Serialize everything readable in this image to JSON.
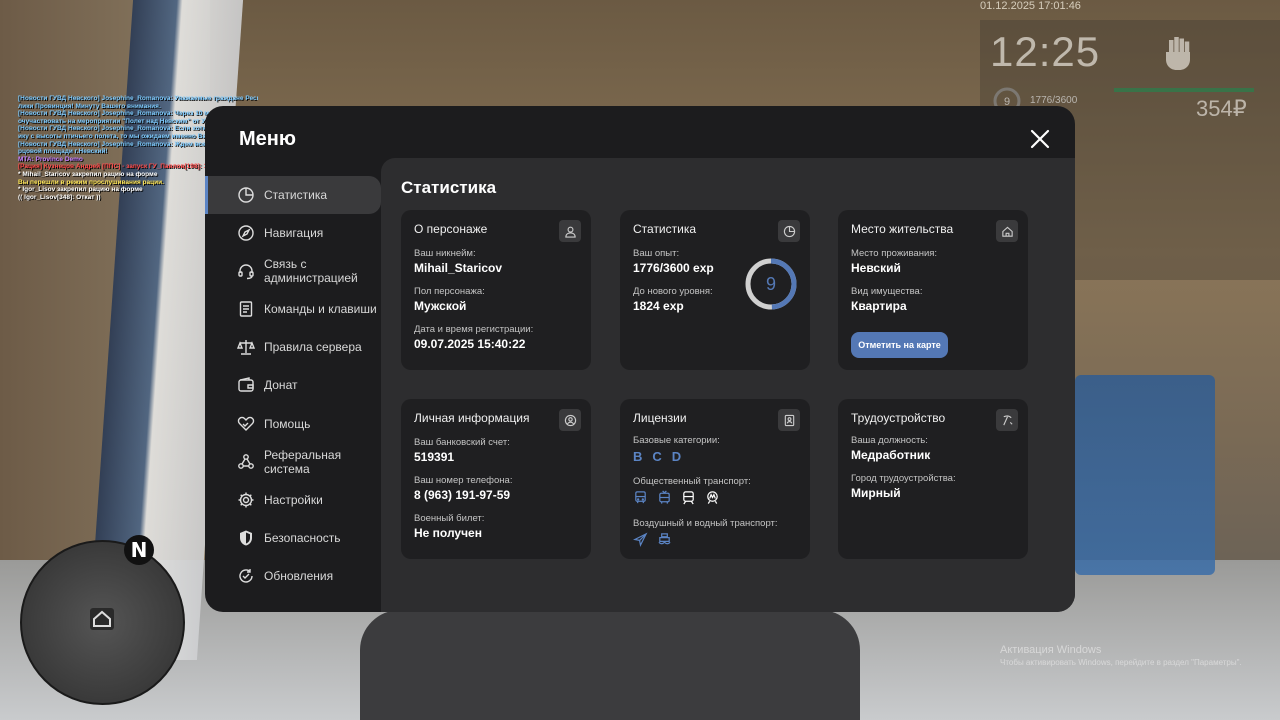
{
  "hud": {
    "datetime": "01.12.2025 17:01:46",
    "time": "12:25",
    "level": "9",
    "exp": "1776/3600",
    "money": "354₽"
  },
  "chat": [
    {
      "text": "[Новости ГУВД Невского] Josephine_Romanova: Уважаемые граждане Респуб",
      "color": "#7ecbff"
    },
    {
      "text": "лики Провинция! Минуту Вашего внимания.",
      "color": "#7ecbff"
    },
    {
      "text": "[Новости ГУВД Невского] Josephine_Romanova: Через 10 минут вы сможете п",
      "color": "#7ecbff"
    },
    {
      "text": "очучаствовать на мероприятии \"Полет над Невским\" от УВД города Невский!",
      "color": "#7ecbff"
    },
    {
      "text": "[Новости ГУВД Невского] Josephine_Romanova: Если хотите увидеть республ",
      "color": "#7ecbff"
    },
    {
      "text": "ику с высоты птичьего полета, то мы ожидаем именно Вас!",
      "color": "#7ecbff"
    },
    {
      "text": "[Новости ГУВД Невского] Josephine_Romanova: Ждем всех желающих на ДВ",
      "color": "#7ecbff"
    },
    {
      "text": "рцовой площади г.Невский!",
      "color": "#7ecbff"
    },
    {
      "text": "MTA: Province Demo",
      "color": "#c07bff"
    },
    {
      "text": "[Рация] Кузнецов Андрей [ППС] - запуск ГУ_Павлов[198]: 103 пр ЗП",
      "color": "#ff4a4a"
    },
    {
      "text": "* Mihail_Staricov закрепил рацию на форме",
      "color": "#ffffff"
    },
    {
      "text": "Вы перешли в режим прослушивания рации.",
      "color": "#ffe75a"
    },
    {
      "text": "* Igor_Lisov закрепил рацию на форме",
      "color": "#ffffff"
    },
    {
      "text": "(( Igor_Lisov[348]: Откат ))",
      "color": "#ffffff"
    }
  ],
  "windows": {
    "line1": "Активация Windows",
    "line2": "Чтобы активировать Windows, перейдите в раздел \"Параметры\"."
  },
  "minimap": {
    "north": "N"
  },
  "menu": {
    "title": "Меню",
    "sidebar": [
      {
        "label": "Статистика",
        "icon": "pie-chart-icon",
        "active": true
      },
      {
        "label": "Навигация",
        "icon": "compass-icon"
      },
      {
        "label": "Связь с администрацией",
        "icon": "headset-icon"
      },
      {
        "label": "Команды и клавиши",
        "icon": "document-icon"
      },
      {
        "label": "Правила сервера",
        "icon": "scales-icon"
      },
      {
        "label": "Донат",
        "icon": "wallet-icon"
      },
      {
        "label": "Помощь",
        "icon": "handshake-heart-icon"
      },
      {
        "label": "Реферальная система",
        "icon": "network-icon"
      },
      {
        "label": "Настройки",
        "icon": "gear-icon"
      },
      {
        "label": "Безопасность",
        "icon": "shield-icon"
      },
      {
        "label": "Обновления",
        "icon": "refresh-check-icon"
      }
    ],
    "content": {
      "title": "Статистика",
      "character": {
        "title": "О персонаже",
        "nick_label": "Ваш никнейм:",
        "nick": "Mihail_Staricov",
        "gender_label": "Пол персонажа:",
        "gender": "Мужской",
        "reg_label": "Дата и время регистрации:",
        "reg": "09.07.2025 15:40:22"
      },
      "stats": {
        "title": "Статистика",
        "exp_label": "Ваш опыт:",
        "exp": "1776/3600 exp",
        "next_label": "До нового уровня:",
        "next": "1824 exp",
        "level": "9",
        "progress": 0.493
      },
      "residence": {
        "title": "Место жительства",
        "place_label": "Место проживания:",
        "place": "Невский",
        "property_label": "Вид имущества:",
        "property": "Квартира",
        "button": "Отметить на карте"
      },
      "personal": {
        "title": "Личная информация",
        "bank_label": "Ваш банковский счет:",
        "bank": "519391",
        "phone_label": "Ваш номер телефона:",
        "phone": "8 (963) 191-97-59",
        "military_label": "Военный билет:",
        "military": "Не получен"
      },
      "licenses": {
        "title": "Лицензии",
        "base_label": "Базовые категории:",
        "categories": [
          "B",
          "C",
          "D"
        ],
        "public_label": "Общественный транспорт:",
        "air_label": "Воздушный и водный транспорт:"
      },
      "employment": {
        "title": "Трудоустройство",
        "position_label": "Ваша должность:",
        "position": "Медработник",
        "city_label": "Город трудоустройства:",
        "city": "Мирный"
      }
    }
  },
  "colors": {
    "accent": "#5b84c4",
    "card": "#1f1f21",
    "panel": "#2d2d2f",
    "menu": "#1c1c1e"
  }
}
